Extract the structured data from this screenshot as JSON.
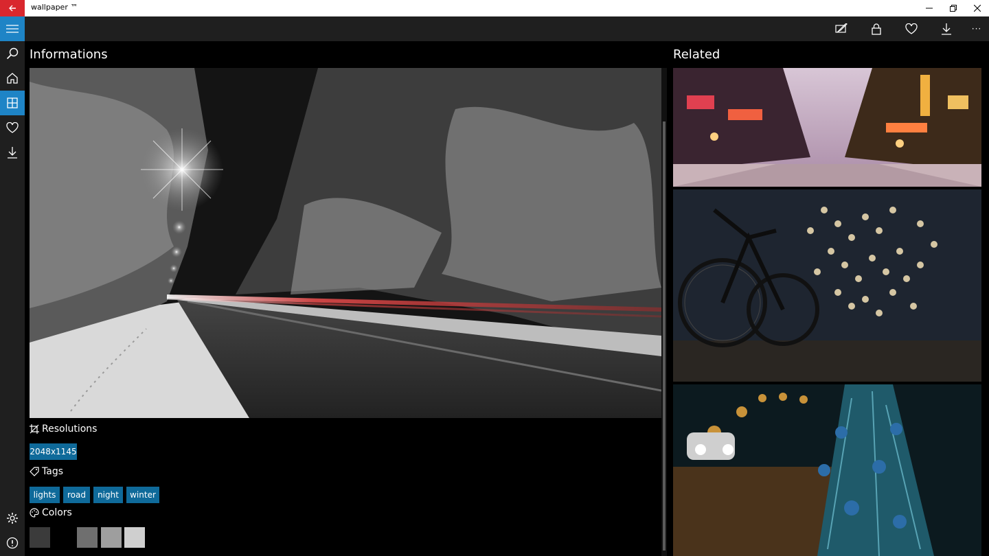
{
  "window": {
    "title": "wallpaper ™"
  },
  "icons": {
    "back": "arrow-left-icon",
    "menu": "hamburger-icon",
    "search": "search-icon",
    "home": "home-icon",
    "collections": "grid-icon",
    "favorites": "heart-icon",
    "downloads": "download-icon",
    "settings": "gear-icon",
    "about": "info-icon",
    "set_wallpaper": "set-wallpaper-icon",
    "lock_screen": "lock-icon",
    "favorite": "heart-icon",
    "download": "download-icon",
    "more": "more-icon"
  },
  "toolbar": {
    "more_label": "···"
  },
  "main": {
    "title": "Informations",
    "resolutions_label": "Resolutions",
    "resolutions": [
      "2048x1145"
    ],
    "tags_label": "Tags",
    "tags": [
      "lights",
      "road",
      "night",
      "winter"
    ],
    "colors_label": "Colors",
    "colors": [
      "#3b3b3b",
      "#000000",
      "#6f6f6f",
      "#9e9e9e",
      "#cfcfcf"
    ]
  },
  "related": {
    "title": "Related"
  },
  "theme": {
    "accent": "#1e84c6",
    "chip": "#0f6a9a",
    "close_red": "#d9272e"
  }
}
